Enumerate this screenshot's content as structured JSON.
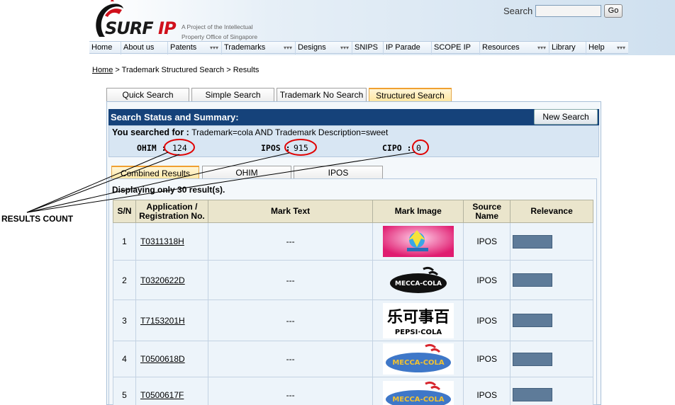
{
  "header": {
    "logo_text": "SURF",
    "logo_text_ip": "IP",
    "tagline_line1": "A Project of the Intellectual",
    "tagline_line2": "Property Office of Singapore",
    "search_label": "Search",
    "search_value": "",
    "go_label": "Go"
  },
  "nav": {
    "items": [
      {
        "label": "Home"
      },
      {
        "label": "About us"
      },
      {
        "label": "Patents"
      },
      {
        "label": "Trademarks"
      },
      {
        "label": "Designs"
      },
      {
        "label": "SNIPS"
      },
      {
        "label": "IP Parade"
      },
      {
        "label": "SCOPE IP"
      },
      {
        "label": "Resources"
      },
      {
        "label": "Library"
      },
      {
        "label": "Help"
      }
    ]
  },
  "breadcrumb": {
    "home": "Home",
    "rest": " > Trademark Structured Search > Results"
  },
  "search_tabs": [
    "Quick Search",
    "Simple Search",
    "Trademark No Search",
    "Structured Search"
  ],
  "status": {
    "heading": "Search Status and Summary:",
    "new_search": "New Search",
    "you_searched_label": "You searched for : ",
    "query": "Trademark=cola AND Trademark Description=sweet",
    "counts": [
      {
        "label": "OHIM :",
        "value": "124"
      },
      {
        "label": "IPOS :",
        "value": "915"
      },
      {
        "label": "CIPO :",
        "value": "0"
      }
    ]
  },
  "result_tabs": [
    "Combined Results",
    "OHIM",
    "IPOS"
  ],
  "displaying": "Displaying only 30 result(s).",
  "table": {
    "headers": [
      "S/N",
      "Application / Registration No.",
      "Mark Text",
      "Mark Image",
      "Source Name",
      "Relevance"
    ],
    "rows": [
      {
        "sn": "1",
        "app": "T0311318H",
        "mark_text": "---",
        "source": "IPOS"
      },
      {
        "sn": "2",
        "app": "T0320622D",
        "mark_text": "---",
        "source": "IPOS"
      },
      {
        "sn": "3",
        "app": "T7153201H",
        "mark_text": "---",
        "source": "IPOS"
      },
      {
        "sn": "4",
        "app": "T0500618D",
        "mark_text": "---",
        "source": "IPOS"
      },
      {
        "sn": "5",
        "app": "T0500617F",
        "mark_text": "---",
        "source": "IPOS"
      }
    ]
  },
  "mark_images": {
    "mecca_cola": "MECCA-COLA",
    "pepsi_chinese": "百事可乐",
    "pepsi_cola": "PEPSI·COLA"
  },
  "annotation": "RESULTS COUNT",
  "colors": {
    "status_header": "#15427a",
    "relevance_bar": "#5e7b99",
    "annotation_circle": "#e00000"
  }
}
